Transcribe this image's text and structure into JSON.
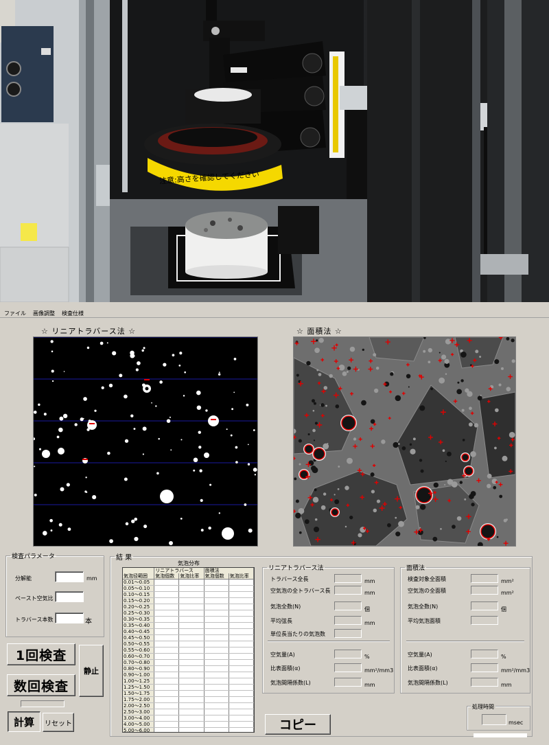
{
  "photo": {
    "warning_label": "注意:高さを確認してください"
  },
  "menu": [
    "ファイル",
    "画像調整",
    "検査仕様"
  ],
  "sections": {
    "linear_title": "☆ リニアトラバース法 ☆",
    "area_title": "☆ 面積法 ☆"
  },
  "params": {
    "legend": "検査パラメータ",
    "resolution_label": "分解能",
    "resolution_unit": "mm",
    "paste_air_label": "ペースト空気比",
    "traverse_count_label": "トラバース本数",
    "traverse_count_unit": "本"
  },
  "buttons": {
    "single_inspect": "1回検査",
    "multi_inspect": "数回検査",
    "stop": "静止",
    "calculate": "計算",
    "reset": "リセット",
    "copy": "コピー"
  },
  "results": {
    "legend": "結 果",
    "distribution_title": "気泡分布",
    "table": {
      "group_linear": "リニアトラバース",
      "group_area": "面積法",
      "columns": [
        "気泡径範囲",
        "気泡個数",
        "気泡比率",
        "気泡個数",
        "気泡比率"
      ],
      "ranges": [
        "0.01〜0.05",
        "0.05〜0.10",
        "0.10〜0.15",
        "0.15〜0.20",
        "0.20〜0.25",
        "0.25〜0.30",
        "0.30〜0.35",
        "0.35〜0.40",
        "0.40〜0.45",
        "0.45〜0.50",
        "0.50〜0.55",
        "0.55〜0.60",
        "0.60〜0.70",
        "0.70〜0.80",
        "0.80〜0.90",
        "0.90〜1.00",
        "1.00〜1.25",
        "1.25〜1.50",
        "1.50〜1.75",
        "1.75〜2.00",
        "2.00〜2.50",
        "2.50〜3.00",
        "3.00〜4.00",
        "4.00〜5.00",
        "5.00〜6.00"
      ]
    }
  },
  "linear": {
    "legend": "リニアトラバース法",
    "rows": [
      {
        "label": "トラバース全長",
        "unit": "mm"
      },
      {
        "label": "空気泡の全トラバース長",
        "unit": "mm"
      },
      {
        "label": "気泡全数(N)",
        "unit": "個"
      },
      {
        "label": "平均弦長",
        "unit": "mm"
      },
      {
        "label": "単位長当たりの気泡数",
        "unit": ""
      }
    ],
    "rows2": [
      {
        "label": "空気量(A)",
        "unit": "%"
      },
      {
        "label": "比表面積(α)",
        "unit": "mm²/mm3"
      },
      {
        "label": "気泡間隔係数(L)",
        "unit": "mm"
      }
    ]
  },
  "area": {
    "legend": "面積法",
    "rows": [
      {
        "label": "検査対象全面積",
        "unit": "mm²"
      },
      {
        "label": "空気泡の全面積",
        "unit": "mm²"
      },
      {
        "label": "気泡全数(N)",
        "unit": "個"
      },
      {
        "label": "平均気泡面積",
        "unit": ""
      }
    ],
    "rows2": [
      {
        "label": "空気量(A)",
        "unit": "%"
      },
      {
        "label": "比表面積(α)",
        "unit": "mm²/mm3"
      },
      {
        "label": "気泡間隔係数(L)",
        "unit": "mm"
      }
    ]
  },
  "processing": {
    "legend": "処理時間",
    "unit": "msec"
  },
  "colors": {
    "traverse_line": "#1a1aa0",
    "bubble_marker": "#e00000",
    "warning_band": "#f5d800"
  }
}
